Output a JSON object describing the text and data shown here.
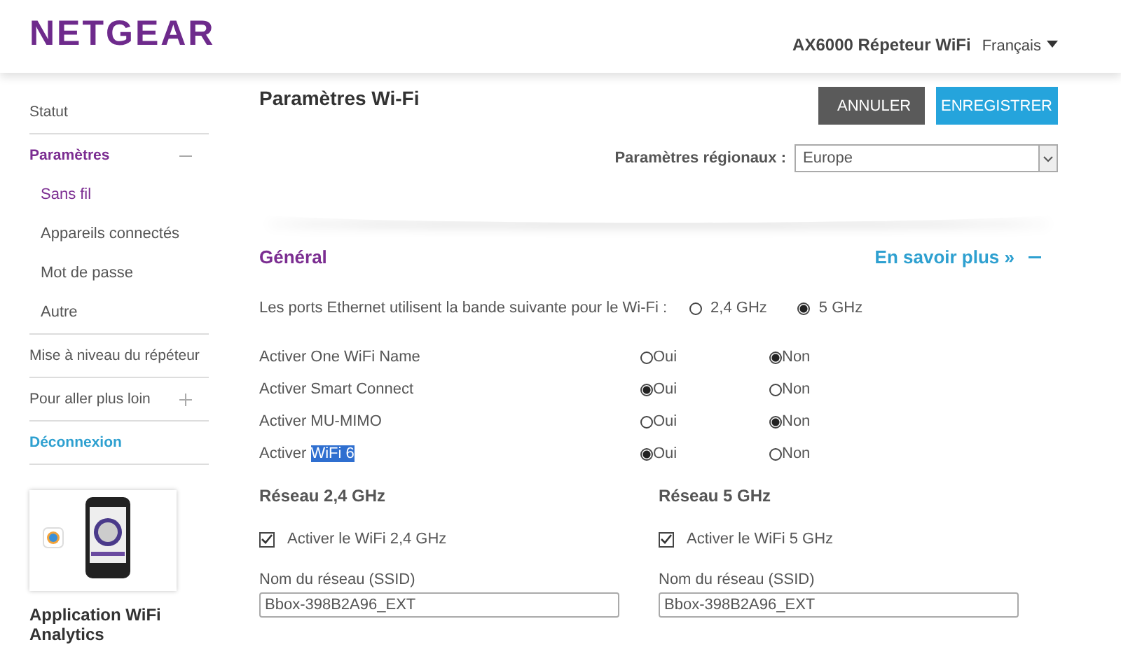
{
  "header": {
    "logo": "NETGEAR",
    "product": "AX6000 Répeteur WiFi",
    "language": "Français"
  },
  "sidebar": {
    "items": [
      {
        "label": "Statut",
        "kind": "link",
        "selected": false
      },
      {
        "label": "Paramètres",
        "kind": "section",
        "selected": true,
        "expanded": true,
        "children": [
          {
            "label": "Sans fil",
            "selected": true
          },
          {
            "label": "Appareils connectés",
            "selected": false
          },
          {
            "label": "Mot de passe",
            "selected": false
          },
          {
            "label": "Autre",
            "selected": false
          }
        ]
      },
      {
        "label": "Mise à niveau du répéteur",
        "kind": "link",
        "selected": false
      },
      {
        "label": "Pour aller plus loin",
        "kind": "section",
        "selected": false,
        "expanded": false
      },
      {
        "label": "Déconnexion",
        "kind": "logout",
        "selected": false
      }
    ],
    "app_promo": {
      "title": "Application WiFi Analytics"
    }
  },
  "page": {
    "title": "Paramètres Wi-Fi",
    "buttons": [
      {
        "label": "ANNULER",
        "kind": "cancel"
      },
      {
        "label": "ENREGISTRER",
        "kind": "save"
      }
    ],
    "region": {
      "label": "Paramètres régionaux :",
      "value": "Europe"
    }
  },
  "general": {
    "title": "Général",
    "learn_more": "En savoir plus »",
    "expanded": true,
    "ethernet": {
      "label": "Les ports Ethernet utilisent la bande suivante pour le Wi-Fi :",
      "options": [
        {
          "label": "2,4 GHz",
          "selected": false
        },
        {
          "label": "5 GHz",
          "selected": true
        }
      ]
    },
    "toggles": [
      {
        "label": "Activer One WiFi Name",
        "options": [
          {
            "label": "Oui",
            "selected": false
          },
          {
            "label": "Non",
            "selected": true
          }
        ]
      },
      {
        "label": "Activer Smart Connect",
        "options": [
          {
            "label": "Oui",
            "selected": true
          },
          {
            "label": "Non",
            "selected": false
          }
        ]
      },
      {
        "label": "Activer MU-MIMO",
        "options": [
          {
            "label": "Oui",
            "selected": false
          },
          {
            "label": "Non",
            "selected": true
          }
        ]
      },
      {
        "label": "Activer",
        "highlighted_text": "WiFi 6",
        "options": [
          {
            "label": "Oui",
            "selected": true
          },
          {
            "label": "Non",
            "selected": false
          }
        ]
      }
    ]
  },
  "networks": [
    {
      "title": "Réseau 2,4 GHz",
      "enable": {
        "label": "Activer le WiFi 2,4 GHz",
        "checked": true
      },
      "ssid": {
        "label": "Nom du réseau (SSID)",
        "value": "Bbox-398B2A96_EXT"
      }
    },
    {
      "title": "Réseau 5 GHz",
      "enable": {
        "label": "Activer le WiFi 5 GHz",
        "checked": true
      },
      "ssid": {
        "label": "Nom du réseau (SSID)",
        "value": "Bbox-398B2A96_EXT"
      }
    }
  ]
}
